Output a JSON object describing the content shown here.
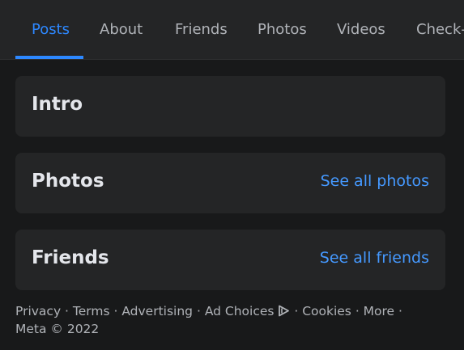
{
  "tabs": [
    {
      "label": "Posts",
      "active": true
    },
    {
      "label": "About",
      "active": false
    },
    {
      "label": "Friends",
      "active": false
    },
    {
      "label": "Photos",
      "active": false
    },
    {
      "label": "Videos",
      "active": false
    },
    {
      "label": "Check-",
      "active": false
    }
  ],
  "cards": {
    "intro": {
      "title": "Intro"
    },
    "photos": {
      "title": "Photos",
      "link": "See all photos"
    },
    "friends": {
      "title": "Friends",
      "link": "See all friends"
    }
  },
  "footer": {
    "privacy": "Privacy",
    "terms": "Terms",
    "advertising": "Advertising",
    "ad_choices": "Ad Choices",
    "ad_choices_icon": "adchoices-icon",
    "cookies": "Cookies",
    "more": "More",
    "meta": "Meta © 2022",
    "separator": " · "
  },
  "colors": {
    "accent": "#2d88ff",
    "background": "#18191a",
    "card": "#242526"
  }
}
